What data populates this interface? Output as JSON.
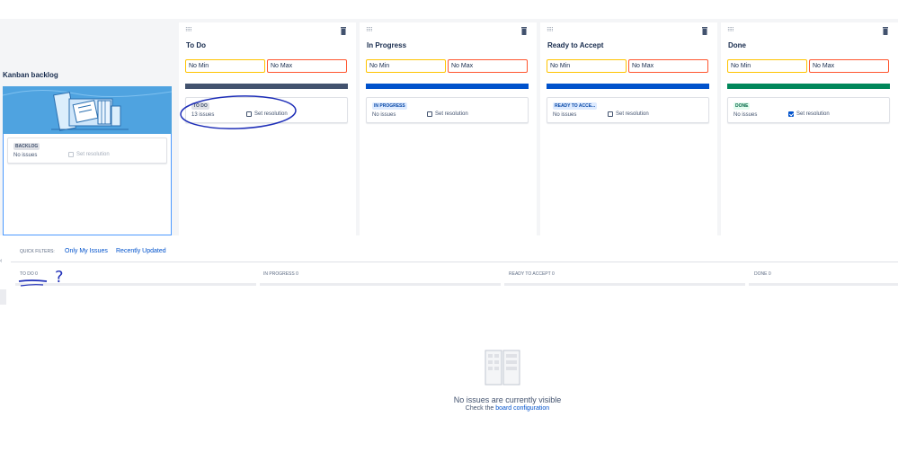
{
  "backlog": {
    "title": "Kanban backlog",
    "lozenge": "BACKLOG",
    "count": "No issues",
    "resolution": "Set resolution"
  },
  "columns": [
    {
      "title": "To Do",
      "min_placeholder": "No Min",
      "max_placeholder": "No Max",
      "status": "TO DO",
      "count": "13 issues",
      "resolution": "Set resolution",
      "resolution_checked": false,
      "bar_color": "#42526e"
    },
    {
      "title": "In Progress",
      "min_placeholder": "No Min",
      "max_placeholder": "No Max",
      "status": "IN PROGRESS",
      "count": "No issues",
      "resolution": "Set resolution",
      "resolution_checked": false,
      "bar_color": "#0052cc"
    },
    {
      "title": "Ready to Accept",
      "min_placeholder": "No Min",
      "max_placeholder": "No Max",
      "status": "READY TO ACCE...",
      "count": "No issues",
      "resolution": "Set resolution",
      "resolution_checked": false,
      "bar_color": "#0052cc"
    },
    {
      "title": "Done",
      "min_placeholder": "No Min",
      "max_placeholder": "No Max",
      "status": "DONE",
      "count": "No issues",
      "resolution": "Set resolution",
      "resolution_checked": true,
      "bar_color": "#00875a"
    }
  ],
  "quick_filters": {
    "label": "QUICK FILTERS:",
    "items": [
      "Only My Issues",
      "Recently Updated"
    ]
  },
  "board_columns": [
    "TO DO 0",
    "IN PROGRESS 0",
    "READY TO ACCEPT 0",
    "DONE 0"
  ],
  "empty_state": {
    "title": "No issues are currently visible",
    "sub_prefix": "Check the",
    "sub_link": "board configuration"
  },
  "colors": {
    "accent": "#0052cc",
    "todo_bar": "#42526e",
    "done_bar": "#00875a",
    "min_border": "#ffc400",
    "max_border": "#ff5630",
    "annotation": "#1f2fb8"
  },
  "annotation": {
    "question_mark": "?"
  }
}
